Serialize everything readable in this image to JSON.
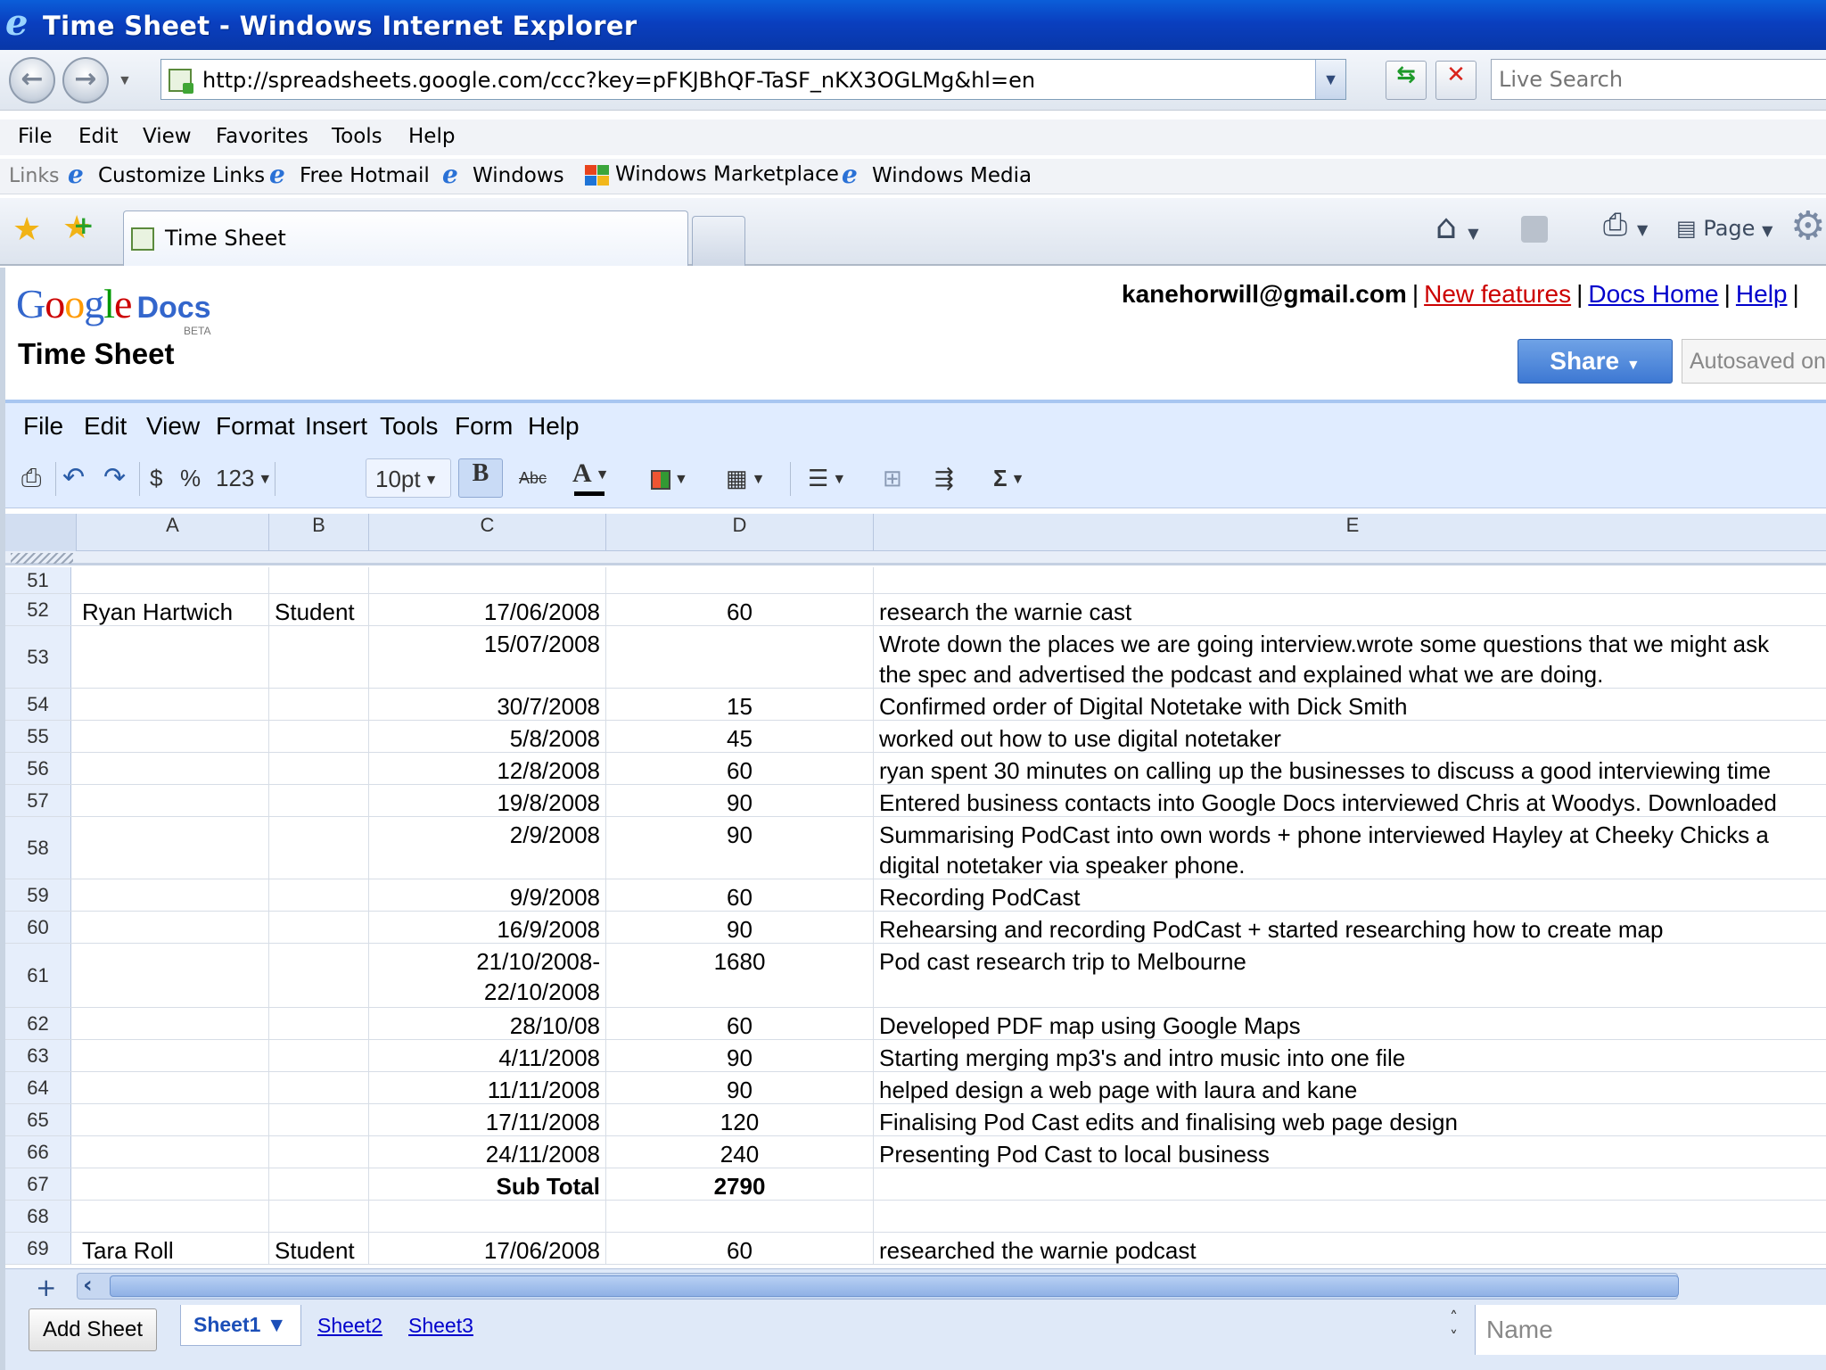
{
  "window": {
    "title": "Time Sheet - Windows Internet Explorer"
  },
  "address": {
    "url": "http://spreadsheets.google.com/ccc?key=pFKJBhQF-TaSF_nKX3OGLMg&hl=en",
    "search_placeholder": "Live Search"
  },
  "ie_menu": [
    "File",
    "Edit",
    "View",
    "Favorites",
    "Tools",
    "Help"
  ],
  "links": {
    "label": "Links",
    "items": [
      "Customize Links",
      "Free Hotmail",
      "Windows",
      "Windows Marketplace",
      "Windows Media"
    ]
  },
  "tab": {
    "title": "Time Sheet"
  },
  "commandbar": {
    "page_label": "Page"
  },
  "gdocs": {
    "logo_google": "Google",
    "logo_docs": "Docs",
    "logo_beta": "BETA",
    "doc_title": "Time Sheet",
    "user_email": "kanehorwill@gmail.com",
    "new_features": "New features",
    "docs_home": "Docs Home",
    "help": "Help",
    "share_label": "Share",
    "autosaved": "Autosaved on"
  },
  "doc_menu": [
    "File",
    "Edit",
    "View",
    "Format",
    "Insert",
    "Tools",
    "Form",
    "Help"
  ],
  "toolbar": {
    "currency": "$",
    "percent": "%",
    "number_format": "123",
    "font_size": "10pt",
    "bold": "B",
    "strike": "Abc",
    "text_color": "A",
    "sum": "Σ"
  },
  "columns": [
    "A",
    "B",
    "C",
    "D",
    "E"
  ],
  "rows": [
    {
      "n": "51",
      "a": "",
      "b": "",
      "c": "",
      "d": "",
      "e": "",
      "h": 30
    },
    {
      "n": "52",
      "a": "Ryan Hartwich",
      "b": "Student",
      "c": "17/06/2008",
      "d": "60",
      "e": "research the warnie cast",
      "h": 36
    },
    {
      "n": "53",
      "a": "",
      "b": "",
      "c": "15/07/2008",
      "d": "",
      "e": "Wrote down the places we are going interview.wrote some questions that we might ask\nthe spec and advertised the podcast and explained what we are doing.",
      "h": 70
    },
    {
      "n": "54",
      "a": "",
      "b": "",
      "c": "30/7/2008",
      "d": "15",
      "e": "Confirmed order of Digital Notetake with Dick Smith",
      "h": 36
    },
    {
      "n": "55",
      "a": "",
      "b": "",
      "c": "5/8/2008",
      "d": "45",
      "e": "worked out how to use digital notetaker",
      "h": 36
    },
    {
      "n": "56",
      "a": "",
      "b": "",
      "c": "12/8/2008",
      "d": "60",
      "e": "ryan spent 30 minutes on calling up the businesses to discuss a good interviewing time",
      "h": 36
    },
    {
      "n": "57",
      "a": "",
      "b": "",
      "c": "19/8/2008",
      "d": "90",
      "e": "Entered business contacts into Google Docs interviewed Chris at Woodys. Downloaded",
      "h": 36
    },
    {
      "n": "58",
      "a": "",
      "b": "",
      "c": "2/9/2008",
      "d": "90",
      "e": "Summarising PodCast into own words + phone interviewed Hayley at Cheeky Chicks a\ndigital notetaker via speaker phone.",
      "h": 70
    },
    {
      "n": "59",
      "a": "",
      "b": "",
      "c": "9/9/2008",
      "d": "60",
      "e": "Recording PodCast",
      "h": 36
    },
    {
      "n": "60",
      "a": "",
      "b": "",
      "c": "16/9/2008",
      "d": "90",
      "e": "Rehearsing and recording PodCast + started researching how to create map",
      "h": 36
    },
    {
      "n": "61",
      "a": "",
      "b": "",
      "c": "21/10/2008-\n22/10/2008",
      "d": "1680",
      "e": "Pod cast research trip to Melbourne",
      "h": 72
    },
    {
      "n": "62",
      "a": "",
      "b": "",
      "c": "28/10/08",
      "d": "60",
      "e": "Developed PDF map using Google Maps",
      "h": 36
    },
    {
      "n": "63",
      "a": "",
      "b": "",
      "c": "4/11/2008",
      "d": "90",
      "e": "Starting merging mp3's and intro music into one file",
      "h": 36
    },
    {
      "n": "64",
      "a": "",
      "b": "",
      "c": "11/11/2008",
      "d": "90",
      "e": "helped design a web page with laura and kane",
      "h": 36
    },
    {
      "n": "65",
      "a": "",
      "b": "",
      "c": "17/11/2008",
      "d": "120",
      "e": "Finalising Pod Cast edits and finalising web page design",
      "h": 36
    },
    {
      "n": "66",
      "a": "",
      "b": "",
      "c": "24/11/2008",
      "d": "240",
      "e": "Presenting Pod Cast to local business",
      "h": 36
    },
    {
      "n": "67",
      "a": "",
      "b": "",
      "c": "Sub Total",
      "d": "2790",
      "e": "",
      "h": 36,
      "bold": true
    },
    {
      "n": "68",
      "a": "",
      "b": "",
      "c": "",
      "d": "",
      "e": "",
      "h": 36
    },
    {
      "n": "69",
      "a": "Tara Roll",
      "b": "Student",
      "c": "17/06/2008",
      "d": "60",
      "e": "researched the warnie podcast",
      "h": 36
    }
  ],
  "sheets": {
    "add_label": "Add Sheet",
    "tabs": [
      "Sheet1 ▼",
      "Sheet2",
      "Sheet3"
    ],
    "name_placeholder": "Name"
  }
}
